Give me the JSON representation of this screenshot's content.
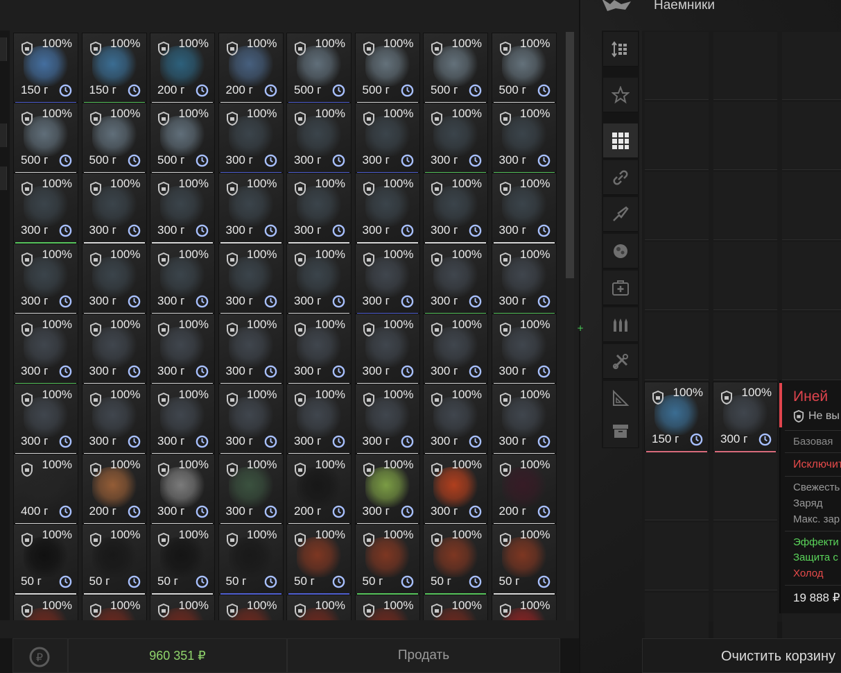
{
  "header": {
    "right_title": "Наемники"
  },
  "inventory": {
    "rows": [
      [
        [
          "100%",
          "150 г",
          "#4a7cb5",
          "#4f5fd1"
        ],
        [
          "100%",
          "150 г",
          "#3f7aa6",
          "#57c45c"
        ],
        [
          "100%",
          "200 г",
          "#2f6b8b",
          ""
        ],
        [
          "100%",
          "200 г",
          "#4d6a8e",
          ""
        ],
        [
          "100%",
          "500 г",
          "#6b7c89",
          "#4f5fd1"
        ],
        [
          "100%",
          "500 г",
          "#6f7f8a",
          ""
        ],
        [
          "100%",
          "500 г",
          "#6f7f8a",
          ""
        ],
        [
          "100%",
          "500 г",
          "#6f7f8a",
          ""
        ]
      ],
      [
        [
          "100%",
          "500 г",
          "#6b7c89",
          ""
        ],
        [
          "100%",
          "500 г",
          "#6b7c89",
          ""
        ],
        [
          "100%",
          "500 г",
          "#6b7c89",
          ""
        ],
        [
          "100%",
          "300 г",
          "#3f4a52",
          "#4f5fd1"
        ],
        [
          "100%",
          "300 г",
          "#3f4a52",
          "#4f5fd1"
        ],
        [
          "100%",
          "300 г",
          "#3f4a52",
          "#4f5fd1"
        ],
        [
          "100%",
          "300 г",
          "#3f4a52",
          "#57c45c"
        ],
        [
          "100%",
          "300 г",
          "#3f4a52",
          "#57c45c"
        ]
      ],
      [
        [
          "100%",
          "300 г",
          "#3f4a52",
          "#57c45c"
        ],
        [
          "100%",
          "300 г",
          "#3f4a52",
          ""
        ],
        [
          "100%",
          "300 г",
          "#3f4a52",
          ""
        ],
        [
          "100%",
          "300 г",
          "#3f4a52",
          ""
        ],
        [
          "100%",
          "300 г",
          "#3f4a52",
          ""
        ],
        [
          "100%",
          "300 г",
          "#3f4a52",
          ""
        ],
        [
          "100%",
          "300 г",
          "#3f4a52",
          ""
        ],
        [
          "100%",
          "300 г",
          "#3f4a52",
          ""
        ]
      ],
      [
        [
          "100%",
          "300 г",
          "#3f4a52",
          ""
        ],
        [
          "100%",
          "300 г",
          "#3f4a52",
          ""
        ],
        [
          "100%",
          "300 г",
          "#3f4a52",
          ""
        ],
        [
          "100%",
          "300 г",
          "#3f4a52",
          ""
        ],
        [
          "100%",
          "300 г",
          "#3f4a52",
          ""
        ],
        [
          "100%",
          "300 г",
          "#454c55",
          "#4f5fd1"
        ],
        [
          "100%",
          "300 г",
          "#454c55",
          "#57c45c"
        ],
        [
          "100%",
          "300 г",
          "#454c55",
          "#57c45c"
        ]
      ],
      [
        [
          "100%",
          "300 г",
          "#454c55",
          "#57c45c"
        ],
        [
          "100%",
          "300 г",
          "#454c55",
          ""
        ],
        [
          "100%",
          "300 г",
          "#454c55",
          ""
        ],
        [
          "100%",
          "300 г",
          "#454c55",
          ""
        ],
        [
          "100%",
          "300 г",
          "#454c55",
          ""
        ],
        [
          "100%",
          "300 г",
          "#454c55",
          ""
        ],
        [
          "100%",
          "300 г",
          "#454c55",
          ""
        ],
        [
          "100%",
          "300 г",
          "#454c55",
          ""
        ]
      ],
      [
        [
          "100%",
          "300 г",
          "#454c55",
          ""
        ],
        [
          "100%",
          "300 г",
          "#454c55",
          ""
        ],
        [
          "100%",
          "300 г",
          "#454c55",
          ""
        ],
        [
          "100%",
          "300 г",
          "#454c55",
          ""
        ],
        [
          "100%",
          "300 г",
          "#454c55",
          ""
        ],
        [
          "100%",
          "300 г",
          "#454c55",
          ""
        ],
        [
          "100%",
          "300 г",
          "#454c55",
          ""
        ],
        [
          "100%",
          "300 г",
          "#454c55",
          ""
        ]
      ],
      [
        [
          "100%",
          "400 г",
          "#252525",
          ""
        ],
        [
          "100%",
          "200 г",
          "#a8673a",
          ""
        ],
        [
          "100%",
          "300 г",
          "#8a8a8a",
          ""
        ],
        [
          "100%",
          "300 г",
          "#3f5a44",
          ""
        ],
        [
          "100%",
          "200 г",
          "#151515",
          ""
        ],
        [
          "100%",
          "300 г",
          "#8ab14a",
          ""
        ],
        [
          "100%",
          "300 г",
          "#c9441d",
          ""
        ],
        [
          "100%",
          "200 г",
          "#3a1a26",
          ""
        ]
      ],
      [
        [
          "100%",
          "50 г",
          "#0d0d0d",
          ""
        ],
        [
          "100%",
          "50 г",
          "#161616",
          ""
        ],
        [
          "100%",
          "50 г",
          "#121212",
          ""
        ],
        [
          "100%",
          "50 г",
          "#171717",
          "#4f5fd1"
        ],
        [
          "100%",
          "50 г",
          "#8d3a22",
          "#4f5fd1"
        ],
        [
          "100%",
          "50 г",
          "#8d3a22",
          "#57c45c"
        ],
        [
          "100%",
          "50 г",
          "#8d3a22",
          "#57c45c"
        ],
        [
          "100%",
          "50 г",
          "#8d3a22",
          ""
        ]
      ],
      [
        [
          "100%",
          "",
          "#7a2a1e",
          ""
        ],
        [
          "100%",
          "",
          "#7a2a1e",
          ""
        ],
        [
          "100%",
          "",
          "#7a2a1e",
          ""
        ],
        [
          "100%",
          "",
          "#7a2a1e",
          ""
        ],
        [
          "100%",
          "",
          "#7a2a1e",
          ""
        ],
        [
          "100%",
          "",
          "#7a2a1e",
          ""
        ],
        [
          "100%",
          "",
          "#7a2a1e",
          ""
        ],
        [
          "100%",
          "",
          "#9b2323",
          ""
        ]
      ]
    ]
  },
  "bottom_bar": {
    "balance": "960 351 ₽",
    "sell_label": "Продать"
  },
  "cart": {
    "items": [
      {
        "pct": "100%",
        "weight": "150 г",
        "color": "#3f7aa6",
        "bar": "#d96b7b"
      },
      {
        "pct": "100%",
        "weight": "300 г",
        "color": "#454c55",
        "bar": "#d96b7b"
      }
    ],
    "clear_label": "Очистить корзину"
  },
  "tooltip": {
    "title": "Иней",
    "subtitle": "Не вы",
    "base": "Базовая",
    "exclusive": "Исключит",
    "freshness": "Свежесть",
    "charge": "Заряд",
    "max_charge": "Макс. зар",
    "effect": "Эффекти",
    "protection": "Защита с",
    "cold": "Холод",
    "price": "19 888 ₽"
  },
  "colors": {
    "accent_red": "#e0444d",
    "balance_green": "#8fd46b",
    "effect_green": "#5ad45a",
    "cold_red": "#e64a4a"
  }
}
